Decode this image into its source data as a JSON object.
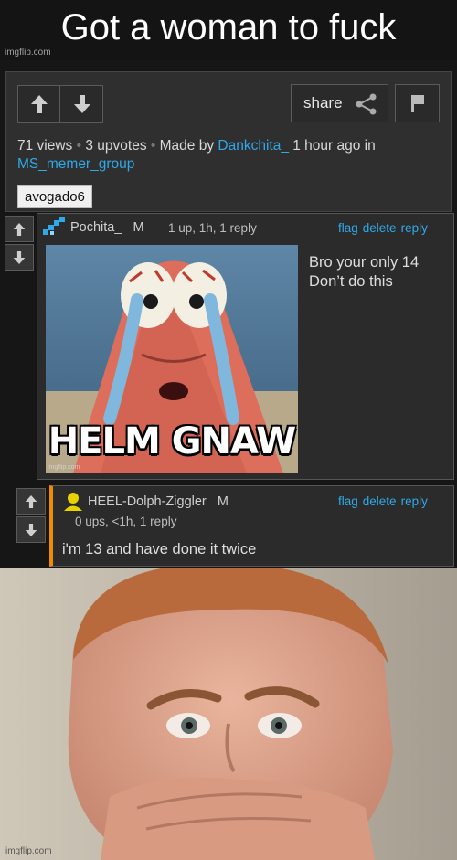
{
  "caption_top": "Got a woman to fuck",
  "watermark": "imgflip.com",
  "post": {
    "share_label": "share",
    "views": "71 views",
    "upvotes": "3 upvotes",
    "made_by_prefix": "Made by",
    "author": "Dankchita_",
    "time": "1 hour ago in",
    "stream": "MS_memer_group",
    "tag": "avogado6"
  },
  "comment": {
    "username": "Pochita_",
    "gender": "M",
    "stats": "1 up, 1h, 1 reply",
    "actions": [
      "flag",
      "delete",
      "reply"
    ],
    "text_line1": "Bro your only 14",
    "text_line2": "Don’t do this",
    "image_caption": "HELM GNAW"
  },
  "reply": {
    "username": "HEEL-Dolph-Ziggler",
    "gender": "M",
    "stats": "0 ups, <1h, 1 reply",
    "actions": [
      "flag",
      "delete",
      "reply"
    ],
    "text": "i'm 13 and have done it twice",
    "accent_color": "#f08a00"
  },
  "colors": {
    "link": "#2fa9e8",
    "panel": "#2f2f2f",
    "background": "#161616"
  },
  "icons": [
    "upvote-arrow-icon",
    "downvote-arrow-icon",
    "share-icon",
    "flag-icon",
    "user-avatar-icon"
  ]
}
